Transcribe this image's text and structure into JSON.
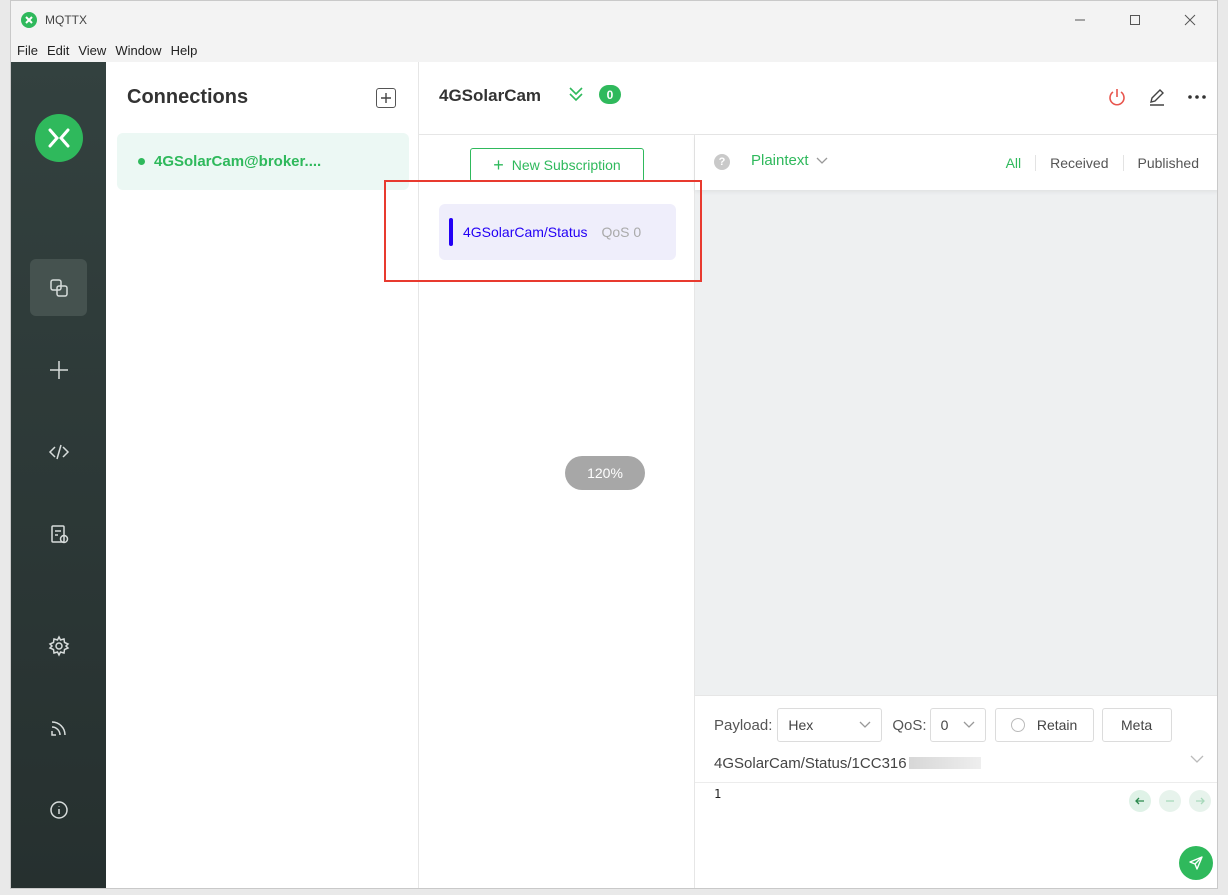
{
  "window": {
    "title": "MQTTX"
  },
  "menu": [
    "File",
    "Edit",
    "View",
    "Window",
    "Help"
  ],
  "connections": {
    "header": "Connections",
    "items": [
      {
        "label": "4GSolarCam@broker....",
        "status": "connected"
      }
    ]
  },
  "connection": {
    "name": "4GSolarCam",
    "message_count": "0"
  },
  "subscriptions": {
    "new_button": "New Subscription",
    "items": [
      {
        "topic": "4GSolarCam/Status",
        "qos": "QoS 0",
        "color": "#2300f5"
      }
    ]
  },
  "zoom_indicator": "120%",
  "messages": {
    "format": "Plaintext",
    "filters": [
      "All",
      "Received",
      "Published"
    ],
    "selected_filter": "All"
  },
  "publish": {
    "payload_label": "Payload:",
    "payload_type": "Hex",
    "qos_label": "QoS:",
    "qos_value": "0",
    "retain_label": "Retain",
    "meta_label": "Meta",
    "topic": "4GSolarCam/Status/1CC316",
    "payload": "1"
  },
  "colors": {
    "accent": "#2fb95c",
    "highlight": "#e83a2f",
    "topic": "#2300f5"
  }
}
